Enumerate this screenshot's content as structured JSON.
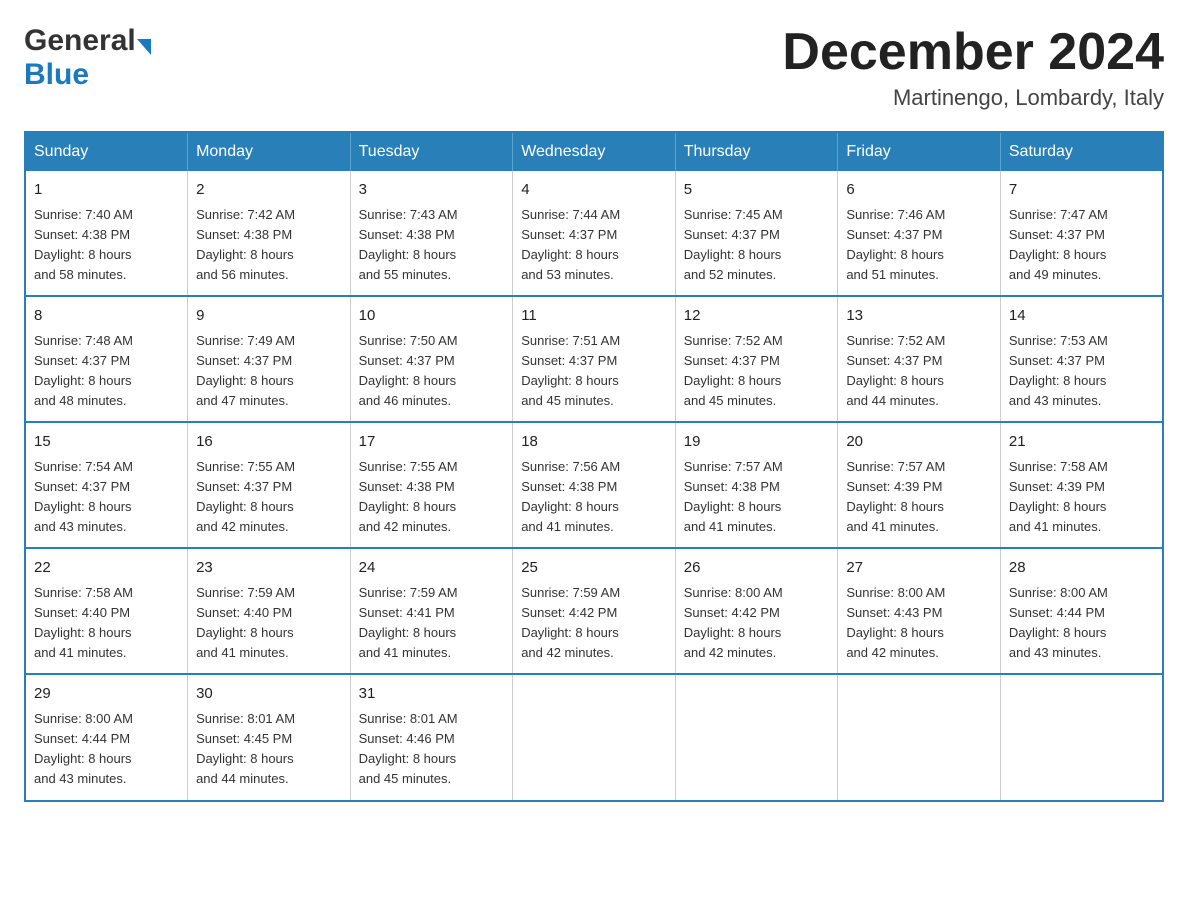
{
  "header": {
    "logo_general": "General",
    "logo_blue": "Blue",
    "month_title": "December 2024",
    "location": "Martinengo, Lombardy, Italy"
  },
  "days_of_week": [
    "Sunday",
    "Monday",
    "Tuesday",
    "Wednesday",
    "Thursday",
    "Friday",
    "Saturday"
  ],
  "weeks": [
    [
      {
        "day": "1",
        "sunrise": "7:40 AM",
        "sunset": "4:38 PM",
        "daylight": "8 hours and 58 minutes."
      },
      {
        "day": "2",
        "sunrise": "7:42 AM",
        "sunset": "4:38 PM",
        "daylight": "8 hours and 56 minutes."
      },
      {
        "day": "3",
        "sunrise": "7:43 AM",
        "sunset": "4:38 PM",
        "daylight": "8 hours and 55 minutes."
      },
      {
        "day": "4",
        "sunrise": "7:44 AM",
        "sunset": "4:37 PM",
        "daylight": "8 hours and 53 minutes."
      },
      {
        "day": "5",
        "sunrise": "7:45 AM",
        "sunset": "4:37 PM",
        "daylight": "8 hours and 52 minutes."
      },
      {
        "day": "6",
        "sunrise": "7:46 AM",
        "sunset": "4:37 PM",
        "daylight": "8 hours and 51 minutes."
      },
      {
        "day": "7",
        "sunrise": "7:47 AM",
        "sunset": "4:37 PM",
        "daylight": "8 hours and 49 minutes."
      }
    ],
    [
      {
        "day": "8",
        "sunrise": "7:48 AM",
        "sunset": "4:37 PM",
        "daylight": "8 hours and 48 minutes."
      },
      {
        "day": "9",
        "sunrise": "7:49 AM",
        "sunset": "4:37 PM",
        "daylight": "8 hours and 47 minutes."
      },
      {
        "day": "10",
        "sunrise": "7:50 AM",
        "sunset": "4:37 PM",
        "daylight": "8 hours and 46 minutes."
      },
      {
        "day": "11",
        "sunrise": "7:51 AM",
        "sunset": "4:37 PM",
        "daylight": "8 hours and 45 minutes."
      },
      {
        "day": "12",
        "sunrise": "7:52 AM",
        "sunset": "4:37 PM",
        "daylight": "8 hours and 45 minutes."
      },
      {
        "day": "13",
        "sunrise": "7:52 AM",
        "sunset": "4:37 PM",
        "daylight": "8 hours and 44 minutes."
      },
      {
        "day": "14",
        "sunrise": "7:53 AM",
        "sunset": "4:37 PM",
        "daylight": "8 hours and 43 minutes."
      }
    ],
    [
      {
        "day": "15",
        "sunrise": "7:54 AM",
        "sunset": "4:37 PM",
        "daylight": "8 hours and 43 minutes."
      },
      {
        "day": "16",
        "sunrise": "7:55 AM",
        "sunset": "4:37 PM",
        "daylight": "8 hours and 42 minutes."
      },
      {
        "day": "17",
        "sunrise": "7:55 AM",
        "sunset": "4:38 PM",
        "daylight": "8 hours and 42 minutes."
      },
      {
        "day": "18",
        "sunrise": "7:56 AM",
        "sunset": "4:38 PM",
        "daylight": "8 hours and 41 minutes."
      },
      {
        "day": "19",
        "sunrise": "7:57 AM",
        "sunset": "4:38 PM",
        "daylight": "8 hours and 41 minutes."
      },
      {
        "day": "20",
        "sunrise": "7:57 AM",
        "sunset": "4:39 PM",
        "daylight": "8 hours and 41 minutes."
      },
      {
        "day": "21",
        "sunrise": "7:58 AM",
        "sunset": "4:39 PM",
        "daylight": "8 hours and 41 minutes."
      }
    ],
    [
      {
        "day": "22",
        "sunrise": "7:58 AM",
        "sunset": "4:40 PM",
        "daylight": "8 hours and 41 minutes."
      },
      {
        "day": "23",
        "sunrise": "7:59 AM",
        "sunset": "4:40 PM",
        "daylight": "8 hours and 41 minutes."
      },
      {
        "day": "24",
        "sunrise": "7:59 AM",
        "sunset": "4:41 PM",
        "daylight": "8 hours and 41 minutes."
      },
      {
        "day": "25",
        "sunrise": "7:59 AM",
        "sunset": "4:42 PM",
        "daylight": "8 hours and 42 minutes."
      },
      {
        "day": "26",
        "sunrise": "8:00 AM",
        "sunset": "4:42 PM",
        "daylight": "8 hours and 42 minutes."
      },
      {
        "day": "27",
        "sunrise": "8:00 AM",
        "sunset": "4:43 PM",
        "daylight": "8 hours and 42 minutes."
      },
      {
        "day": "28",
        "sunrise": "8:00 AM",
        "sunset": "4:44 PM",
        "daylight": "8 hours and 43 minutes."
      }
    ],
    [
      {
        "day": "29",
        "sunrise": "8:00 AM",
        "sunset": "4:44 PM",
        "daylight": "8 hours and 43 minutes."
      },
      {
        "day": "30",
        "sunrise": "8:01 AM",
        "sunset": "4:45 PM",
        "daylight": "8 hours and 44 minutes."
      },
      {
        "day": "31",
        "sunrise": "8:01 AM",
        "sunset": "4:46 PM",
        "daylight": "8 hours and 45 minutes."
      },
      null,
      null,
      null,
      null
    ]
  ],
  "labels": {
    "sunrise": "Sunrise:",
    "sunset": "Sunset:",
    "daylight": "Daylight:"
  }
}
